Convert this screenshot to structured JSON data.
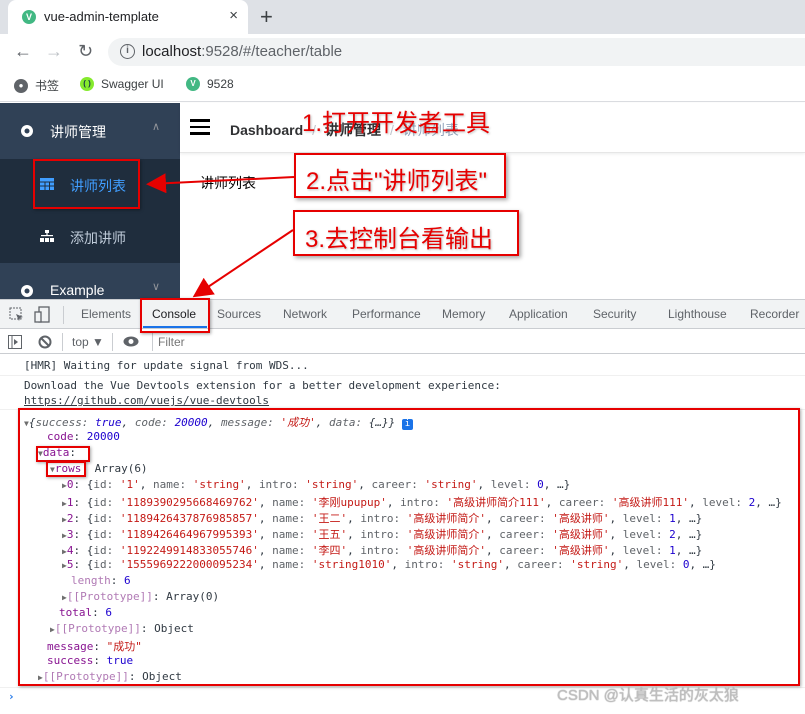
{
  "browser": {
    "tab_title": "vue-admin-template",
    "tab_favicon": "V",
    "new_tab": "+",
    "close_tab": "×",
    "url_host": "localhost",
    "url_rest": ":9528/#/teacher/table",
    "bookmarks": [
      {
        "label": "书签",
        "icon": "globe-icon"
      },
      {
        "label": "Swagger UI",
        "icon": "swagger-icon"
      },
      {
        "label": "9528",
        "icon": "vue-icon"
      }
    ]
  },
  "sidebar": {
    "groups": [
      {
        "label": "讲师管理",
        "icon": "gear-icon",
        "expanded": true,
        "items": [
          {
            "label": "讲师列表",
            "icon": "table-icon",
            "active": true
          },
          {
            "label": "添加讲师",
            "icon": "tree-icon",
            "active": false
          }
        ]
      },
      {
        "label": "Example",
        "icon": "gear-icon",
        "expanded": false
      }
    ]
  },
  "navbar": {
    "breadcrumb": [
      "Dashboard",
      "讲师管理",
      "讲师列表"
    ],
    "separator": "/"
  },
  "page": {
    "content_text": "讲师列表"
  },
  "annotations": [
    "1.打开开发者工具",
    "2.点击\"讲师列表\"",
    "3.去控制台看输出"
  ],
  "devtools": {
    "tabs": [
      "Elements",
      "Console",
      "Sources",
      "Network",
      "Performance",
      "Memory",
      "Application",
      "Security",
      "Lighthouse",
      "Recorder"
    ],
    "active_tab": "Console",
    "context": "top ▼",
    "filter_placeholder": "Filter",
    "messages": {
      "hmr": "[HMR] Waiting for update signal from WDS...",
      "vue_devtools": "Download the Vue Devtools extension for a better development experience:",
      "vue_devtools_link": "https://github.com/vuejs/vue-devtools"
    },
    "object": {
      "summary": {
        "success": "true",
        "code": "20000",
        "message": "'成功'",
        "data": "{…}"
      },
      "code": "20000",
      "rows_type": "Array(6)",
      "rows": [
        {
          "idx": "0",
          "id": "'1'",
          "name": "'string'",
          "intro": "'string'",
          "career": "'string'",
          "level": "0"
        },
        {
          "idx": "1",
          "id": "'1189390295668469762'",
          "name": "'李刚upupup'",
          "intro": "'高级讲师简介111'",
          "career": "'高级讲师111'",
          "level": "2"
        },
        {
          "idx": "2",
          "id": "'1189426437876985857'",
          "name": "'王二'",
          "intro": "'高级讲师简介'",
          "career": "'高级讲师'",
          "level": "1"
        },
        {
          "idx": "3",
          "id": "'1189426464967995393'",
          "name": "'王五'",
          "intro": "'高级讲师简介'",
          "career": "'高级讲师'",
          "level": "2"
        },
        {
          "idx": "4",
          "id": "'1192249914833055746'",
          "name": "'李四'",
          "intro": "'高级讲师简介'",
          "career": "'高级讲师'",
          "level": "1"
        },
        {
          "idx": "5",
          "id": "'1555969222000095234'",
          "name": "'string1010'",
          "intro": "'string'",
          "career": "'string'",
          "level": "0"
        }
      ],
      "length": "6",
      "rows_proto": "Array(0)",
      "total": "6",
      "data_proto": "Object",
      "message": "\"成功\"",
      "success": "true",
      "root_proto": "Object"
    }
  },
  "watermark": "CSDN @认真生活的灰太狼"
}
